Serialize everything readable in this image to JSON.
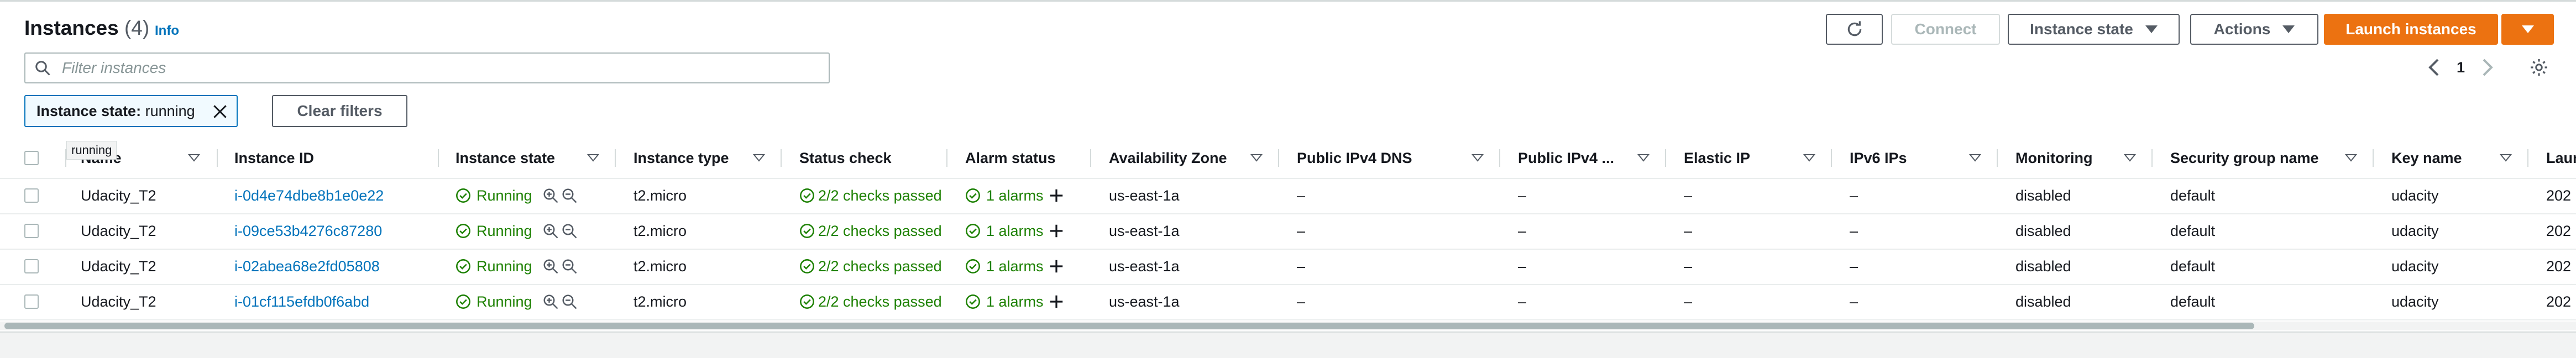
{
  "header": {
    "title": "Instances",
    "count": "(4)",
    "info": "Info"
  },
  "toolbar": {
    "connect": "Connect",
    "instance_state": "Instance state",
    "actions": "Actions",
    "launch": "Launch instances"
  },
  "search": {
    "placeholder": "Filter instances"
  },
  "pagination": {
    "page": "1"
  },
  "filter_chip": {
    "key": "Instance state:",
    "value": "running"
  },
  "clear_filters": "Clear filters",
  "tooltip": "running",
  "columns": [
    "Name",
    "Instance ID",
    "Instance state",
    "Instance type",
    "Status check",
    "Alarm status",
    "Availability Zone",
    "Public IPv4 DNS",
    "Public IPv4 ...",
    "Elastic IP",
    "IPv6 IPs",
    "Monitoring",
    "Security group name",
    "Key name",
    "Laun"
  ],
  "rows": [
    {
      "name": "Udacity_T2",
      "id": "i-0d4e74dbe8b1e0e22",
      "state": "Running",
      "type": "t2.micro",
      "status": "2/2 checks passed",
      "alarm": "1 alarms",
      "az": "us-east-1a",
      "dns": "–",
      "ipv4": "–",
      "eip": "–",
      "ipv6": "–",
      "monitoring": "disabled",
      "sg": "default",
      "key": "udacity",
      "launch": "202"
    },
    {
      "name": "Udacity_T2",
      "id": "i-09ce53b4276c87280",
      "state": "Running",
      "type": "t2.micro",
      "status": "2/2 checks passed",
      "alarm": "1 alarms",
      "az": "us-east-1a",
      "dns": "–",
      "ipv4": "–",
      "eip": "–",
      "ipv6": "–",
      "monitoring": "disabled",
      "sg": "default",
      "key": "udacity",
      "launch": "202"
    },
    {
      "name": "Udacity_T2",
      "id": "i-02abea68e2fd05808",
      "state": "Running",
      "type": "t2.micro",
      "status": "2/2 checks passed",
      "alarm": "1 alarms",
      "az": "us-east-1a",
      "dns": "–",
      "ipv4": "–",
      "eip": "–",
      "ipv6": "–",
      "monitoring": "disabled",
      "sg": "default",
      "key": "udacity",
      "launch": "202"
    },
    {
      "name": "Udacity_T2",
      "id": "i-01cf115efdb0f6abd",
      "state": "Running",
      "type": "t2.micro",
      "status": "2/2 checks passed",
      "alarm": "1 alarms",
      "az": "us-east-1a",
      "dns": "–",
      "ipv4": "–",
      "eip": "–",
      "ipv6": "–",
      "monitoring": "disabled",
      "sg": "default",
      "key": "udacity",
      "launch": "202"
    }
  ],
  "colors": {
    "primary": "#ec7211",
    "link": "#0073bb",
    "success": "#1d8102",
    "border": "#aab7b8"
  }
}
